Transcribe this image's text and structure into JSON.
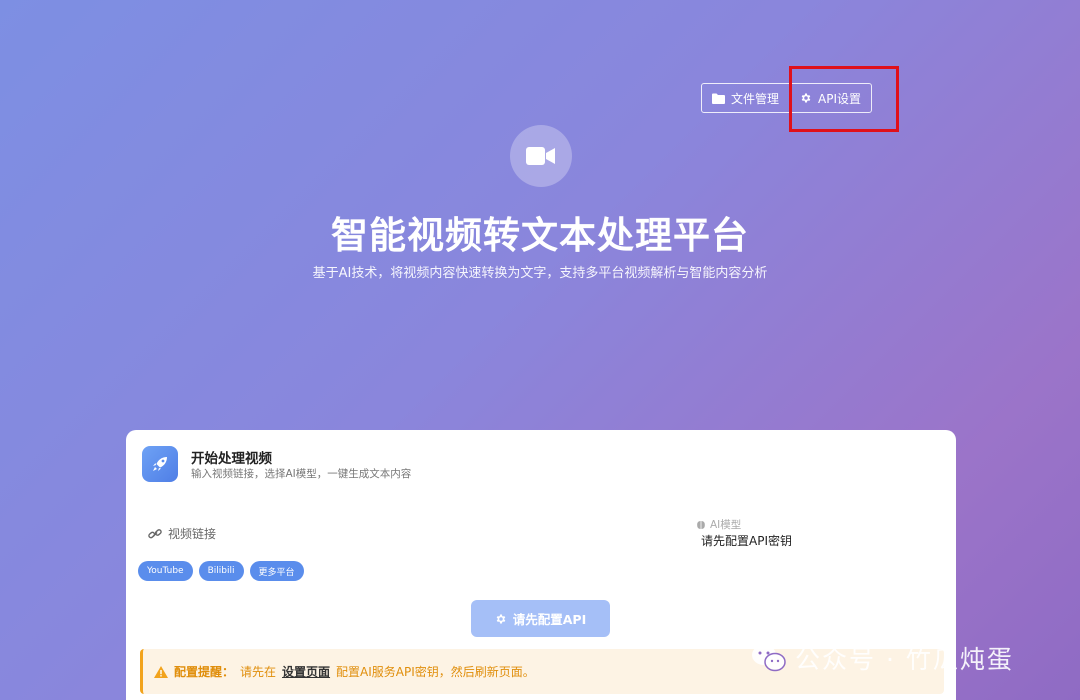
{
  "header": {
    "file_btn_label": "文件管理",
    "api_btn_label": "API设置"
  },
  "hero": {
    "title": "智能视频转文本处理平台",
    "subtitle": "基于AI技术，将视频内容快速转换为文字，支持多平台视频解析与智能内容分析"
  },
  "card": {
    "title": "开始处理视频",
    "description": "输入视频链接，选择AI模型，一键生成文本内容",
    "video_link_label": "视频链接",
    "model_label": "AI模型",
    "model_value": "请先配置API密钥",
    "platforms": [
      "YouTube",
      "Bilibili",
      "更多平台"
    ],
    "config_button_label": "请先配置API"
  },
  "alert": {
    "title": "配置提醒：",
    "before": "请先在",
    "link": "设置页面",
    "after": "配置AI服务API密钥，然后刷新页面。"
  },
  "watermark": {
    "text": "公众号 · 竹瓜炖蛋"
  },
  "icons": {
    "folder": "folder-icon",
    "gear": "gear-icon",
    "video": "video-camera-icon",
    "rocket": "rocket-icon",
    "link": "link-icon",
    "brain": "brain-icon",
    "warning": "warning-icon"
  },
  "colors": {
    "accent": "#5a8dec",
    "highlight": "#e0101a",
    "warning": "#f2a31c"
  }
}
